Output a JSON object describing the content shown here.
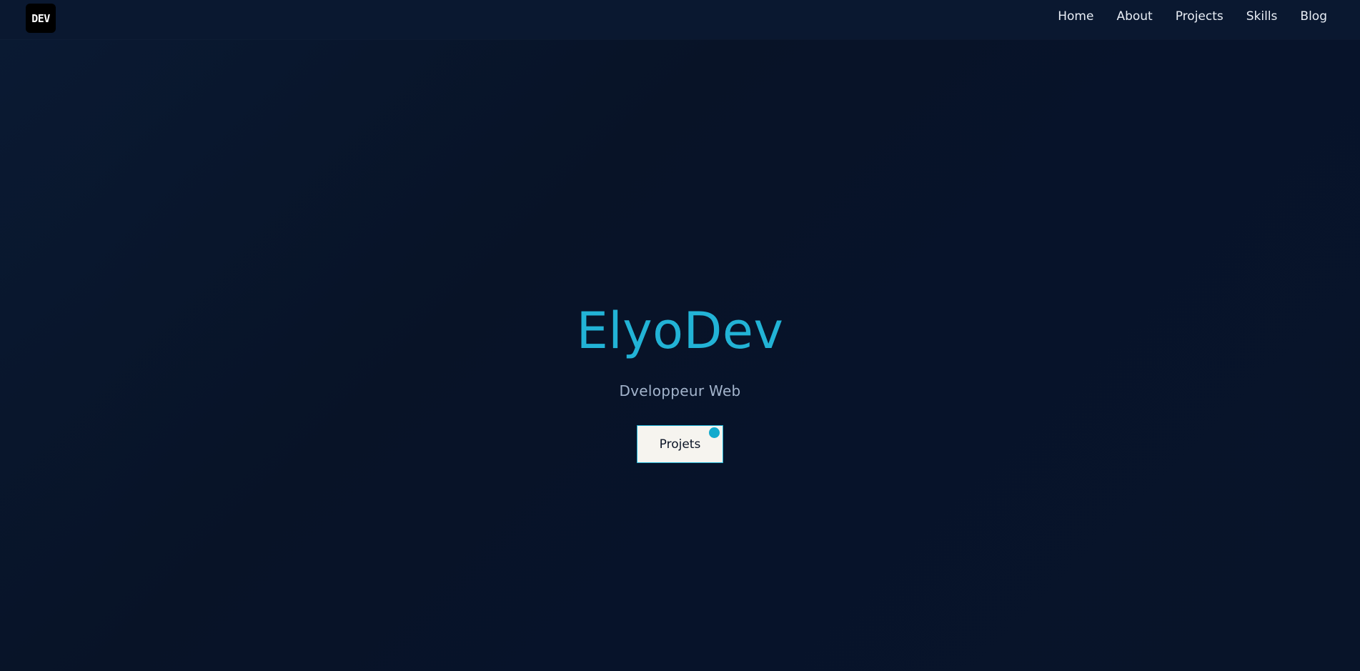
{
  "header": {
    "logo_text": "DEV",
    "nav": [
      {
        "label": "Home"
      },
      {
        "label": "About"
      },
      {
        "label": "Projects"
      },
      {
        "label": "Skills"
      },
      {
        "label": "Blog"
      }
    ]
  },
  "hero": {
    "title": "ElyoDev",
    "subtitle": "Dveloppeur Web",
    "cta_label": "Projets"
  },
  "colors": {
    "background": "#081327",
    "header_bg": "#0a1830",
    "accent": "#22b3d6",
    "subtitle": "#a3b4cc",
    "button_bg": "#f6f4ef",
    "button_border": "#1fb1d4",
    "button_dot": "#12aacd"
  }
}
